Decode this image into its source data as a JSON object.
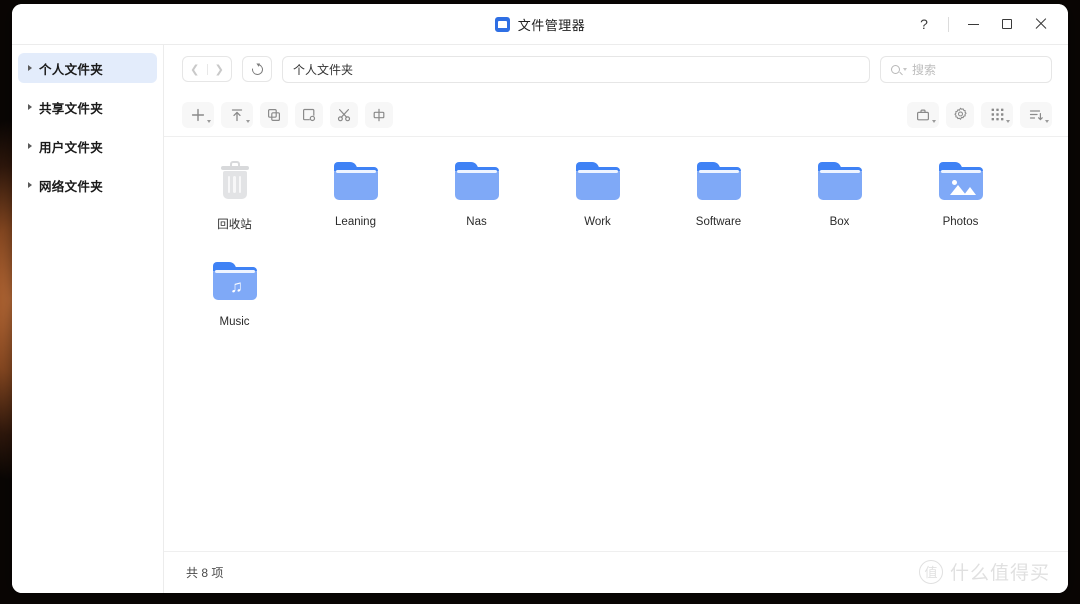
{
  "window": {
    "title": "文件管理器",
    "app_icon": "folder-app-icon",
    "controls": {
      "help": "?",
      "minimize": "minimize-icon",
      "maximize": "maximize-icon",
      "close": "close-icon"
    }
  },
  "sidebar": {
    "items": [
      {
        "label": "个人文件夹",
        "active": true
      },
      {
        "label": "共享文件夹",
        "active": false
      },
      {
        "label": "用户文件夹",
        "active": false
      },
      {
        "label": "网络文件夹",
        "active": false
      }
    ]
  },
  "navbar": {
    "back_icon": "chevron-left-icon",
    "forward_icon": "chevron-right-icon",
    "refresh_icon": "refresh-icon",
    "address_value": "个人文件夹",
    "search_placeholder": "搜索",
    "search_value": ""
  },
  "toolbar": {
    "left": [
      {
        "name": "new-button",
        "icon": "plus-icon",
        "dropdown": true
      },
      {
        "name": "upload-button",
        "icon": "upload-icon",
        "dropdown": true
      },
      {
        "name": "copy-button",
        "icon": "copy-icon",
        "dropdown": false
      },
      {
        "name": "paste-button",
        "icon": "paste-icon",
        "dropdown": false
      },
      {
        "name": "cut-button",
        "icon": "scissors-icon",
        "dropdown": false
      },
      {
        "name": "rename-button",
        "icon": "rename-icon",
        "dropdown": false
      }
    ],
    "right": [
      {
        "name": "toolbox-button",
        "icon": "toolbox-icon",
        "dropdown": true
      },
      {
        "name": "settings-button",
        "icon": "gear-icon",
        "dropdown": false
      },
      {
        "name": "view-mode-button",
        "icon": "grid-icon",
        "dropdown": true
      },
      {
        "name": "sort-button",
        "icon": "sort-icon",
        "dropdown": true
      }
    ]
  },
  "files": [
    {
      "name": "回收站",
      "type": "trash"
    },
    {
      "name": "Leaning",
      "type": "folder"
    },
    {
      "name": "Nas",
      "type": "folder"
    },
    {
      "name": "Work",
      "type": "folder"
    },
    {
      "name": "Software",
      "type": "folder"
    },
    {
      "name": "Box",
      "type": "folder"
    },
    {
      "name": "Photos",
      "type": "folder-photos"
    },
    {
      "name": "Music",
      "type": "folder-music"
    }
  ],
  "statusbar": {
    "count_text": "共 8 项"
  },
  "watermark": {
    "logo": "值",
    "text": "什么值得买"
  },
  "colors": {
    "accent": "#2f6fe4",
    "folder_tab": "#3f82f5",
    "folder_body": "#7fa9f7",
    "sidebar_active": "#e3ecfb",
    "toolbar_button": "#f7f7f7"
  }
}
